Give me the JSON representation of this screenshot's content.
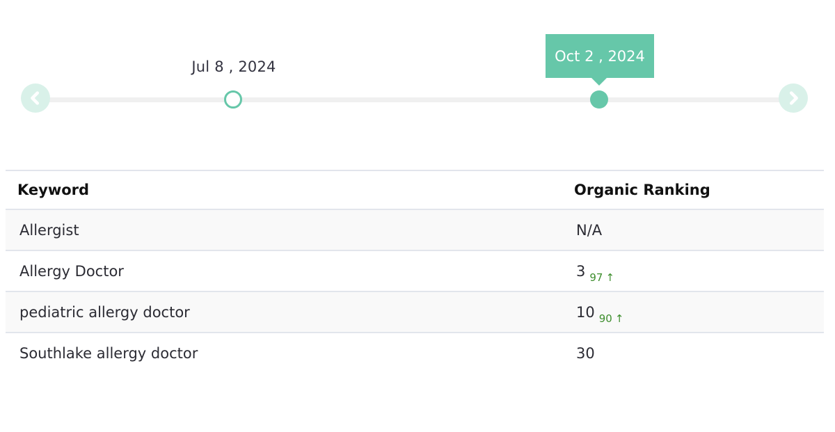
{
  "timeline": {
    "prev_label": "Previous",
    "next_label": "Next",
    "points": [
      {
        "date": "Jul 8 , 2024",
        "selected": false
      },
      {
        "date": "Oct 2 , 2024",
        "selected": true
      }
    ],
    "accent_color": "#66c7a9"
  },
  "table": {
    "headers": [
      "Keyword",
      "Organic Ranking"
    ],
    "rows": [
      {
        "keyword": "Allergist",
        "ranking": "N/A",
        "change": null
      },
      {
        "keyword": "Allergy Doctor",
        "ranking": "3",
        "change": "97",
        "change_direction": "up"
      },
      {
        "keyword": "pediatric allergy doctor",
        "ranking": "10",
        "change": "90",
        "change_direction": "up"
      },
      {
        "keyword": "Southlake allergy doctor",
        "ranking": "30",
        "change": null
      }
    ],
    "up_arrow": "↑",
    "change_color": "#3e8e2e"
  }
}
